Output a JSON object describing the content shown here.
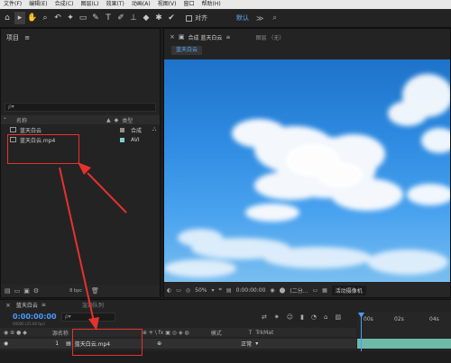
{
  "menu": [
    "文件(F)",
    "编辑(E)",
    "合成(C)",
    "图层(L)",
    "效果(T)",
    "动画(A)",
    "视图(V)",
    "窗口",
    "帮助(H)"
  ],
  "toolbar": {
    "tools": [
      "⌂",
      "▸",
      "✋",
      "⌕",
      "↶",
      "✦",
      "▭",
      "✎",
      "T",
      "✐",
      "⊥",
      "◆",
      "✱",
      "✔"
    ],
    "snap_label": "对齐",
    "workspace_default": "默认",
    "workspace_more": "≫"
  },
  "project": {
    "title": "项目",
    "menu_icon": "≡",
    "search_glyph": "ρ▾",
    "col_name": "名称",
    "col_type": "类型",
    "items": [
      {
        "name": "蓝天白云",
        "type": "合成",
        "chip_color": "#9a8f86"
      },
      {
        "name": "蓝天白云.mp4",
        "type": "AVI",
        "chip_color": "#7bd0d6"
      }
    ],
    "bpc": "8 bpc"
  },
  "composition": {
    "tab_label": "合成 蓝天白云",
    "layer_tab": "图层 （无）",
    "subtab": "蓝天白云",
    "zoom": "50%",
    "timecode": "0:00:00:00",
    "quality": "(二分...",
    "camera": "活动摄像机"
  },
  "timeline": {
    "comp_tab": "蓝天白云",
    "render_queue_tab": "渲染队列",
    "time": "0:00:00:00",
    "frames": "00000 (25.00 fps)",
    "search_glyph": "ρ▾",
    "col_source": "源名称",
    "col_mode": "模式",
    "col_t": "T",
    "col_trkmat": "TrkMat",
    "layer_num": "1",
    "layer_name": "蓝天白云.mp4",
    "layer_mode": "正常",
    "ticks": [
      "00s",
      "02s",
      "04s"
    ]
  }
}
